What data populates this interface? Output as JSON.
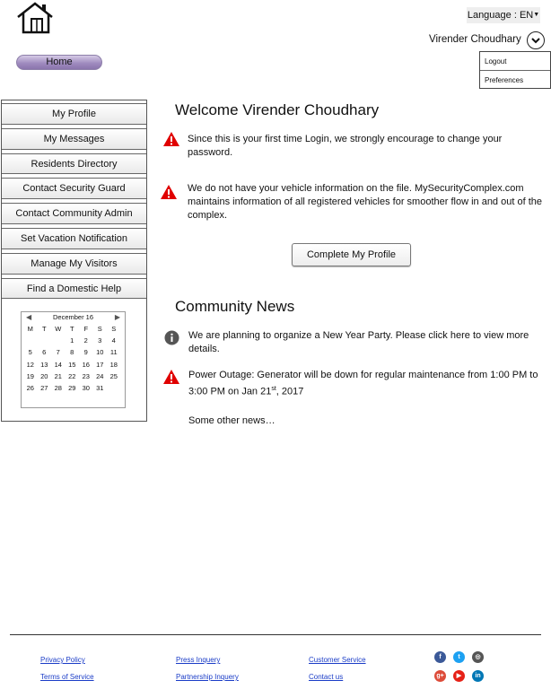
{
  "header": {
    "language_label": "Language : EN",
    "user_name": "Virender Choudhary",
    "user_menu": [
      "Logout",
      "Preferences"
    ],
    "home_label": "Home"
  },
  "sidebar": {
    "items": [
      "My Profile",
      "My Messages",
      "Residents Directory",
      "Contact Security Guard",
      "Contact Community Admin",
      "Set Vacation Notification",
      "Manage My Visitors",
      "Find a Domestic Help"
    ],
    "calendar": {
      "month": "December 16",
      "weekdays": [
        "M",
        "T",
        "W",
        "T",
        "F",
        "S",
        "S"
      ],
      "days": [
        "",
        "",
        "",
        "1",
        "2",
        "3",
        "4",
        "5",
        "6",
        "7",
        "8",
        "9",
        "10",
        "11",
        "12",
        "13",
        "14",
        "15",
        "16",
        "17",
        "18",
        "19",
        "20",
        "21",
        "22",
        "23",
        "24",
        "25",
        "26",
        "27",
        "28",
        "29",
        "30",
        "31",
        ""
      ]
    }
  },
  "main": {
    "welcome": "Welcome Virender Choudhary",
    "alerts": [
      "Since this is your first time Login, we strongly encourage to change your password.",
      "We do not have your vehicle information on the file. MySecurityComplex.com maintains information of all registered vehicles for smoother flow in and out of the complex."
    ],
    "cta_label": "Complete My Profile",
    "news_title": "Community News",
    "news": {
      "item1": "We are planning to organize a New Year Party. Please click here to view more details.",
      "item2_prefix": "Power Outage: Generator will be down for regular maintenance from 1:00 PM to 3:00 PM on Jan 21",
      "item2_sup": "st",
      "item2_suffix": ", 2017",
      "item3": "Some other news…"
    }
  },
  "footer": {
    "links": [
      "Privacy Policy",
      "Terms of Service",
      "Press Inquery",
      "Partnership Inquery",
      "Customer Service",
      "Contact us"
    ]
  },
  "colors": {
    "facebook": "#3b5998",
    "twitter": "#1da1f2",
    "instagram": "#555555",
    "googleplus": "#dd4b39",
    "youtube": "#e62117",
    "linkedin": "#0077b5",
    "alert_red": "#e00000",
    "info_gray": "#555555"
  },
  "icons": [
    "home-icon",
    "chevron-down-icon",
    "warning-icon",
    "info-icon",
    "facebook-icon",
    "twitter-icon",
    "instagram-icon",
    "google-plus-icon",
    "youtube-icon",
    "linkedin-icon"
  ]
}
